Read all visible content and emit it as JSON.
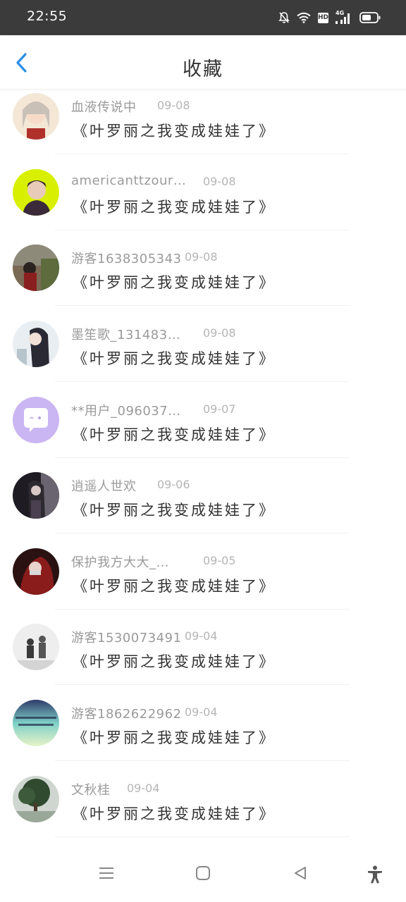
{
  "status_bar": {
    "time": "22:55",
    "icons": [
      "bell-muted-icon",
      "wifi-icon",
      "hd-icon",
      "signal-4g-icon",
      "battery-icon"
    ],
    "hd_label": "HD",
    "network_label": "4G"
  },
  "header": {
    "title": "收藏",
    "back_icon": "chevron-left-icon",
    "accent_color": "#2b8ee6"
  },
  "items": [
    {
      "user": "血液传说中",
      "date": "09-08",
      "title": "《叶罗丽之我变成娃娃了》",
      "avatar_colors": [
        "#f4e7d6",
        "#c9a27a"
      ]
    },
    {
      "user": "americanttzour…",
      "date": "09-08",
      "title": "《叶罗丽之我变成娃娃了》",
      "avatar_colors": [
        "#d8f000",
        "#3a2a3a"
      ]
    },
    {
      "user": "游客1638305343",
      "date": "09-08",
      "title": "《叶罗丽之我变成娃娃了》",
      "avatar_colors": [
        "#7a6a55",
        "#2b2320"
      ]
    },
    {
      "user": "墨笙歌_131483…",
      "date": "09-08",
      "title": "《叶罗丽之我变成娃娃了》",
      "avatar_colors": [
        "#e9eef2",
        "#2a2a35"
      ]
    },
    {
      "user": "**用户_096037…",
      "date": "09-07",
      "title": "《叶罗丽之我变成娃娃了》",
      "avatar_colors": [
        "#c9b6f2",
        "#ffffff"
      ]
    },
    {
      "user": "逍遥人世欢",
      "date": "09-06",
      "title": "《叶罗丽之我变成娃娃了》",
      "avatar_colors": [
        "#6a6470",
        "#1e1c22"
      ]
    },
    {
      "user": "保护我方大大_…",
      "date": "09-05",
      "title": "《叶罗丽之我变成娃娃了》",
      "avatar_colors": [
        "#8a1c1c",
        "#2a1212"
      ]
    },
    {
      "user": "游客1530073491",
      "date": "09-04",
      "title": "《叶罗丽之我变成娃娃了》",
      "avatar_colors": [
        "#eeeeee",
        "#3a3a3a"
      ]
    },
    {
      "user": "游客1862622962",
      "date": "09-04",
      "title": "《叶罗丽之我变成娃娃了》",
      "avatar_colors": [
        "#7fd0c8",
        "#2e3a6a"
      ]
    },
    {
      "user": "文秋桂",
      "date": "09-04",
      "title": "《叶罗丽之我变成娃娃了》",
      "avatar_colors": [
        "#9aa89a",
        "#2f4a2e"
      ]
    }
  ],
  "nav_bar": {
    "buttons": [
      "menu-icon",
      "home-square-icon",
      "back-triangle-icon",
      "accessibility-icon"
    ]
  }
}
